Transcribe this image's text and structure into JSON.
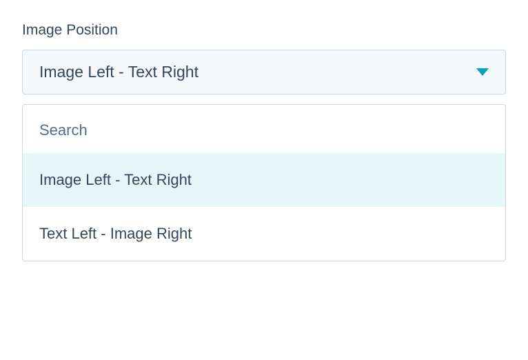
{
  "field": {
    "label": "Image Position",
    "selected_value": "Image Left - Text Right",
    "search_placeholder": "Search",
    "options": [
      {
        "label": "Image Left - Text Right",
        "selected": true
      },
      {
        "label": "Text Left - Image Right",
        "selected": false
      }
    ]
  },
  "colors": {
    "accent": "#00a4bd",
    "text": "#33475b",
    "border": "#cbd6e2",
    "highlight": "#e5f5f8",
    "input_bg": "#f5f8fa"
  }
}
